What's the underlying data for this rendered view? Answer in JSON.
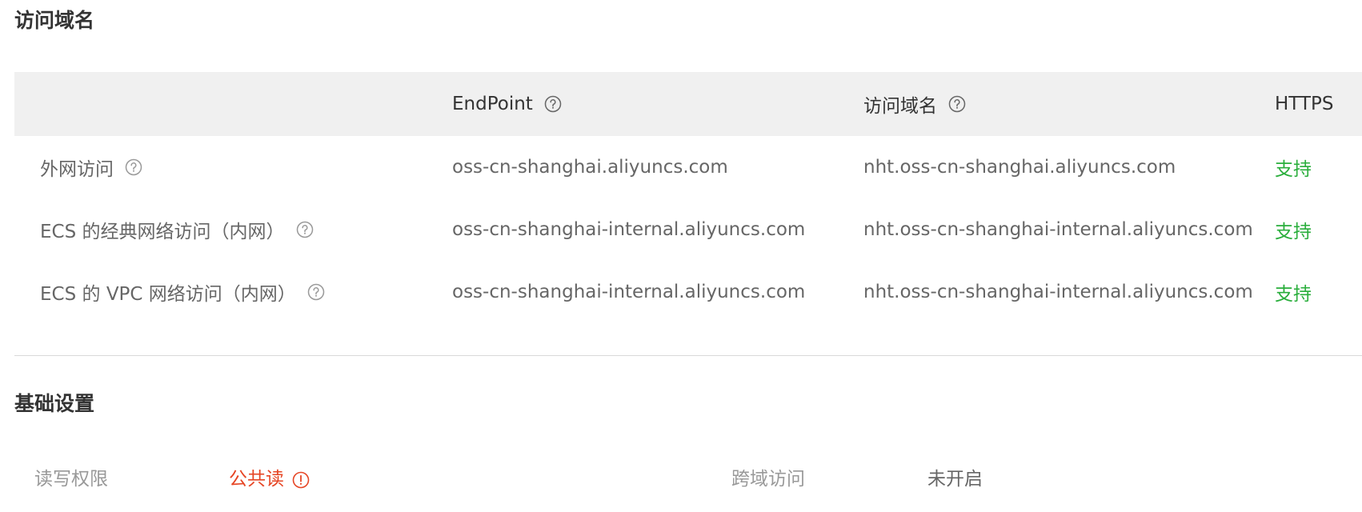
{
  "sections": {
    "domain_title": "访问域名",
    "basic_title": "基础设置"
  },
  "table": {
    "headers": {
      "endpoint": "EndPoint",
      "domain": "访问域名",
      "https": "HTTPS"
    },
    "rows": [
      {
        "type": "外网访问",
        "endpoint": "oss-cn-shanghai.aliyuncs.com",
        "domain": "nht.oss-cn-shanghai.aliyuncs.com",
        "https": "支持"
      },
      {
        "type": "ECS 的经典网络访问（内网）",
        "endpoint": "oss-cn-shanghai-internal.aliyuncs.com",
        "domain": "nht.oss-cn-shanghai-internal.aliyuncs.com",
        "https": "支持"
      },
      {
        "type": "ECS 的 VPC 网络访问（内网）",
        "endpoint": "oss-cn-shanghai-internal.aliyuncs.com",
        "domain": "nht.oss-cn-shanghai-internal.aliyuncs.com",
        "https": "支持"
      }
    ]
  },
  "basic": {
    "rw_label": "读写权限",
    "rw_value": "公共读",
    "cors_label": "跨域访问",
    "cors_value": "未开启"
  },
  "icons": {
    "help": "question-circle-icon",
    "warning": "exclamation-circle-icon"
  },
  "colors": {
    "support_green": "#2aae3c",
    "warning_red": "#e64524",
    "header_bg": "#f0f0f0"
  }
}
